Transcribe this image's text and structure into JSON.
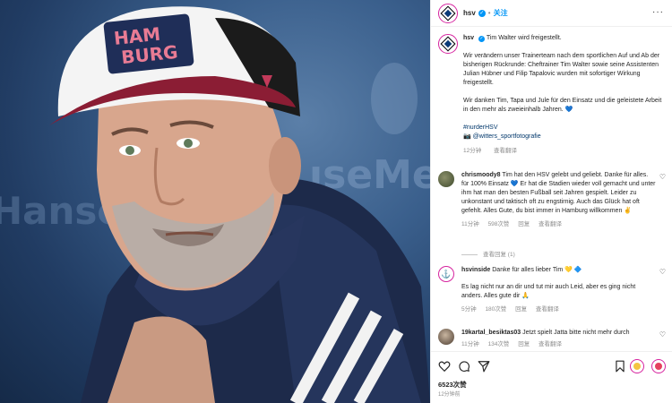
{
  "post": {
    "username": "hsv",
    "follow_label": "关注",
    "caption": {
      "username": "hsv",
      "headline": "Tim Walter wird freigestellt.",
      "para1": "Wir verändern unser Trainerteam nach dem sportlichen Auf und Ab der bisherigen Rückrunde: Cheftrainer Tim Walter sowie seine Assistenten Julian Hübner und Filip Tapalovic wurden mit sofortiger Wirkung freigestellt.",
      "para2": "Wir danken Tim, Tapa und Jule für den Einsatz und die geleistete Arbeit in den mehr als zweieinhalb Jahren. 💙",
      "hashtag": "#nurderHSV",
      "credit": "📷 @witters_sportfotografie",
      "time": "12分钟",
      "translate": "查看翻译"
    },
    "cap_logo_text": "HAMBURG",
    "cap_logo_line1": "HAM",
    "cap_logo_line2": "BURG",
    "bg_text_1": "ıseMe",
    "bg_text_2": "Hanse"
  },
  "comments": [
    {
      "username": "chrismoody8",
      "text": "Tim hat den HSV gelebt und geliebt. Danke für alles. für 100% Einsatz 💙 Er hat die Stadien wieder voll gemacht und unter ihm hat man den besten Fußball seit Jahren gespielt. Leider zu unkonstant und taktisch oft zu engstirnig. Auch das Glück hat oft gefehlt. Alles Gute, du bist immer in Hamburg willkommen ✌️",
      "time": "11分钟",
      "likes": "598次赞",
      "reply": "回复",
      "translate": "查看翻译",
      "view_replies": "查看回复 (1)"
    },
    {
      "username": "hsvinside",
      "text": "Danke für alles lieber Tim 💛 🔷",
      "text2": "Es lag nicht nur an dir und tut mir auch Leid, aber es ging nicht anders. Alles gute dir 🙏",
      "time": "5分钟",
      "likes": "180次赞",
      "reply": "回复",
      "translate": "查看翻译"
    },
    {
      "username": "19kartal_besiktas03",
      "text": "Jetzt spielt Jatta bitte nicht mehr durch",
      "time": "11分钟",
      "likes": "134次赞",
      "reply": "回复",
      "translate": "查看翻译"
    }
  ],
  "footer": {
    "likes": "6523次赞",
    "ago": "12分钟前"
  },
  "colors": {
    "link": "#0095f6",
    "hashtag": "#00376b",
    "muted": "#8e8e8e"
  }
}
